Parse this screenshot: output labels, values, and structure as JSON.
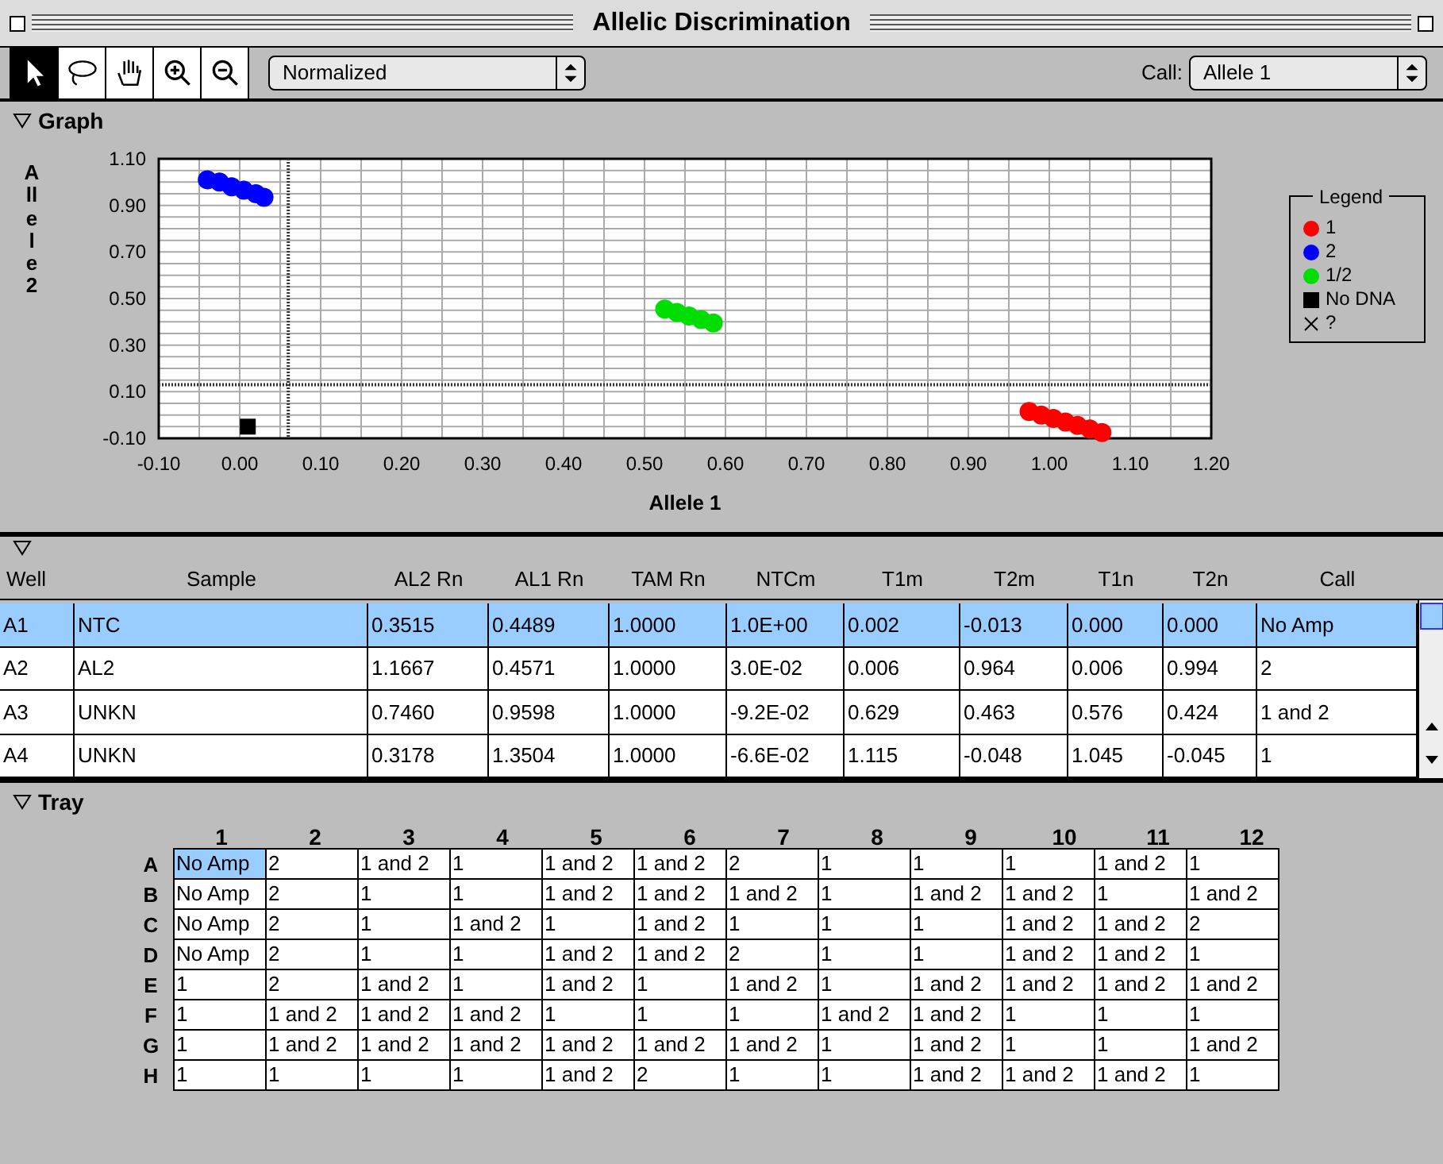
{
  "window": {
    "title": "Allelic Discrimination"
  },
  "toolbar": {
    "tools": [
      {
        "kind": "pointer",
        "selected": true
      },
      {
        "kind": "lasso",
        "selected": false
      },
      {
        "kind": "hand",
        "selected": false
      },
      {
        "kind": "zoom-in",
        "selected": false
      },
      {
        "kind": "zoom-out",
        "selected": false
      }
    ],
    "view_select": {
      "value": "Normalized"
    },
    "call_label": "Call:",
    "call_select": {
      "value": "Allele 1"
    }
  },
  "graph": {
    "title": "Graph",
    "chart_data": {
      "type": "scatter",
      "grid": true,
      "xlabel": "Allele 1",
      "ylabel": "Allele 2",
      "xlim": [
        -0.1,
        1.2
      ],
      "ylim": [
        -0.1,
        1.1
      ],
      "xticks": [
        {
          "value": -0.1,
          "label": "-0.10"
        },
        {
          "value": 0,
          "label": "0.00"
        },
        {
          "value": 0.1,
          "label": "0.10"
        },
        {
          "value": 0.2,
          "label": "0.20"
        },
        {
          "value": 0.3,
          "label": "0.30"
        },
        {
          "value": 0.4,
          "label": "0.40"
        },
        {
          "value": 0.5,
          "label": "0.50"
        },
        {
          "value": 0.6,
          "label": "0.60"
        },
        {
          "value": 0.7,
          "label": "0.70"
        },
        {
          "value": 0.8,
          "label": "0.80"
        },
        {
          "value": 0.9,
          "label": "0.90"
        },
        {
          "value": 1.0,
          "label": "1.00"
        },
        {
          "value": 1.1,
          "label": "1.10"
        },
        {
          "value": 1.2,
          "label": "1.20"
        }
      ],
      "yticks": [
        {
          "value": 1.1,
          "label": "1.10"
        },
        {
          "value": 0.9,
          "label": "0.90"
        },
        {
          "value": 0.7,
          "label": "0.70"
        },
        {
          "value": 0.5,
          "label": "0.50"
        },
        {
          "value": 0.3,
          "label": "0.30"
        },
        {
          "value": 0.1,
          "label": "0.10"
        },
        {
          "value": -0.1,
          "label": "-0.10"
        }
      ],
      "series": [
        {
          "name": "1",
          "color": "#ff0000",
          "marker": "circle",
          "x": [
            0.975,
            0.99,
            1.005,
            1.02,
            1.035,
            1.05,
            1.065
          ],
          "values": [
            0.015,
            0.0,
            -0.015,
            -0.03,
            -0.045,
            -0.06,
            -0.075
          ]
        },
        {
          "name": "2",
          "color": "#0000ff",
          "marker": "circle",
          "x": [
            -0.04,
            -0.025,
            -0.01,
            0.005,
            0.02,
            0.03
          ],
          "values": [
            1.01,
            1.0,
            0.98,
            0.965,
            0.95,
            0.935
          ]
        },
        {
          "name": "1/2",
          "color": "#00dd00",
          "marker": "circle",
          "x": [
            0.525,
            0.54,
            0.555,
            0.57,
            0.585
          ],
          "values": [
            0.455,
            0.44,
            0.425,
            0.41,
            0.395
          ]
        },
        {
          "name": "No DNA",
          "color": "#000000",
          "marker": "square",
          "x": [
            0.01
          ],
          "values": [
            -0.05
          ]
        }
      ],
      "ref_lines": [
        {
          "axis": "x",
          "value": 0.06
        },
        {
          "axis": "y",
          "value": 0.13
        }
      ]
    },
    "legend": {
      "title": "Legend",
      "extra_items": [
        {
          "label": "?",
          "kind": "cross"
        }
      ]
    }
  },
  "table": {
    "columns": [
      "Well",
      "Sample",
      "AL2 Rn",
      "AL1 Rn",
      "TAM Rn",
      "NTCm",
      "T1m",
      "T2m",
      "T1n",
      "T2n",
      "Call"
    ],
    "rows": [
      {
        "selected": true,
        "cells": [
          "A1",
          "NTC",
          "0.3515",
          "0.4489",
          "1.0000",
          "1.0E+00",
          "0.002",
          "-0.013",
          "0.000",
          "0.000",
          "No Amp"
        ]
      },
      {
        "selected": false,
        "cells": [
          "A2",
          "AL2",
          "1.1667",
          "0.4571",
          "1.0000",
          "3.0E-02",
          "0.006",
          "0.964",
          "0.006",
          "0.994",
          "2"
        ]
      },
      {
        "selected": false,
        "cells": [
          "A3",
          "UNKN",
          "0.7460",
          "0.9598",
          "1.0000",
          "-9.2E-02",
          "0.629",
          "0.463",
          "0.576",
          "0.424",
          "1 and 2"
        ]
      },
      {
        "selected": false,
        "cells": [
          "A4",
          "UNKN",
          "0.3178",
          "1.3504",
          "1.0000",
          "-6.6E-02",
          "1.115",
          "-0.048",
          "1.045",
          "-0.045",
          "1"
        ]
      }
    ]
  },
  "tray": {
    "title": "Tray",
    "columns": [
      "1",
      "2",
      "3",
      "4",
      "5",
      "6",
      "7",
      "8",
      "9",
      "10",
      "11",
      "12"
    ],
    "rows": [
      {
        "label": "A",
        "cells": [
          {
            "call": "No Amp",
            "selected": true
          },
          {
            "call": "2",
            "selected": false
          },
          {
            "call": "1 and 2",
            "selected": false
          },
          {
            "call": "1",
            "selected": false
          },
          {
            "call": "1 and 2",
            "selected": false
          },
          {
            "call": "1 and 2",
            "selected": false
          },
          {
            "call": "2",
            "selected": false
          },
          {
            "call": "1",
            "selected": false
          },
          {
            "call": "1",
            "selected": false
          },
          {
            "call": "1",
            "selected": false
          },
          {
            "call": "1 and 2",
            "selected": false
          },
          {
            "call": "1",
            "selected": false
          }
        ]
      },
      {
        "label": "B",
        "cells": [
          {
            "call": "No Amp",
            "selected": false
          },
          {
            "call": "2",
            "selected": false
          },
          {
            "call": "1",
            "selected": false
          },
          {
            "call": "1",
            "selected": false
          },
          {
            "call": "1 and 2",
            "selected": false
          },
          {
            "call": "1 and 2",
            "selected": false
          },
          {
            "call": "1 and 2",
            "selected": false
          },
          {
            "call": "1",
            "selected": false
          },
          {
            "call": "1 and 2",
            "selected": false
          },
          {
            "call": "1 and 2",
            "selected": false
          },
          {
            "call": "1",
            "selected": false
          },
          {
            "call": "1 and 2",
            "selected": false
          }
        ]
      },
      {
        "label": "C",
        "cells": [
          {
            "call": "No Amp",
            "selected": false
          },
          {
            "call": "2",
            "selected": false
          },
          {
            "call": "1",
            "selected": false
          },
          {
            "call": "1 and 2",
            "selected": false
          },
          {
            "call": "1",
            "selected": false
          },
          {
            "call": "1 and 2",
            "selected": false
          },
          {
            "call": "1",
            "selected": false
          },
          {
            "call": "1",
            "selected": false
          },
          {
            "call": "1",
            "selected": false
          },
          {
            "call": "1 and 2",
            "selected": false
          },
          {
            "call": "1 and 2",
            "selected": false
          },
          {
            "call": "2",
            "selected": false
          }
        ]
      },
      {
        "label": "D",
        "cells": [
          {
            "call": "No Amp",
            "selected": false
          },
          {
            "call": "2",
            "selected": false
          },
          {
            "call": "1",
            "selected": false
          },
          {
            "call": "1",
            "selected": false
          },
          {
            "call": "1 and 2",
            "selected": false
          },
          {
            "call": "1 and 2",
            "selected": false
          },
          {
            "call": "2",
            "selected": false
          },
          {
            "call": "1",
            "selected": false
          },
          {
            "call": "1",
            "selected": false
          },
          {
            "call": "1 and 2",
            "selected": false
          },
          {
            "call": "1 and 2",
            "selected": false
          },
          {
            "call": "1",
            "selected": false
          }
        ]
      },
      {
        "label": "E",
        "cells": [
          {
            "call": "1",
            "selected": false
          },
          {
            "call": "2",
            "selected": false
          },
          {
            "call": "1 and 2",
            "selected": false
          },
          {
            "call": "1",
            "selected": false
          },
          {
            "call": "1 and 2",
            "selected": false
          },
          {
            "call": "1",
            "selected": false
          },
          {
            "call": "1 and 2",
            "selected": false
          },
          {
            "call": "1",
            "selected": false
          },
          {
            "call": "1 and 2",
            "selected": false
          },
          {
            "call": "1 and 2",
            "selected": false
          },
          {
            "call": "1 and 2",
            "selected": false
          },
          {
            "call": "1 and 2",
            "selected": false
          }
        ]
      },
      {
        "label": "F",
        "cells": [
          {
            "call": "1",
            "selected": false
          },
          {
            "call": "1 and 2",
            "selected": false
          },
          {
            "call": "1 and 2",
            "selected": false
          },
          {
            "call": "1 and 2",
            "selected": false
          },
          {
            "call": "1",
            "selected": false
          },
          {
            "call": "1",
            "selected": false
          },
          {
            "call": "1",
            "selected": false
          },
          {
            "call": "1 and 2",
            "selected": false
          },
          {
            "call": "1 and 2",
            "selected": false
          },
          {
            "call": "1",
            "selected": false
          },
          {
            "call": "1",
            "selected": false
          },
          {
            "call": "1",
            "selected": false
          }
        ]
      },
      {
        "label": "G",
        "cells": [
          {
            "call": "1",
            "selected": false
          },
          {
            "call": "1 and 2",
            "selected": false
          },
          {
            "call": "1 and 2",
            "selected": false
          },
          {
            "call": "1 and 2",
            "selected": false
          },
          {
            "call": "1 and 2",
            "selected": false
          },
          {
            "call": "1 and 2",
            "selected": false
          },
          {
            "call": "1 and 2",
            "selected": false
          },
          {
            "call": "1",
            "selected": false
          },
          {
            "call": "1 and 2",
            "selected": false
          },
          {
            "call": "1",
            "selected": false
          },
          {
            "call": "1",
            "selected": false
          },
          {
            "call": "1 and 2",
            "selected": false
          }
        ]
      },
      {
        "label": "H",
        "cells": [
          {
            "call": "1",
            "selected": false
          },
          {
            "call": "1",
            "selected": false
          },
          {
            "call": "1",
            "selected": false
          },
          {
            "call": "1",
            "selected": false
          },
          {
            "call": "1 and 2",
            "selected": false
          },
          {
            "call": "2",
            "selected": false
          },
          {
            "call": "1",
            "selected": false
          },
          {
            "call": "1",
            "selected": false
          },
          {
            "call": "1 and 2",
            "selected": false
          },
          {
            "call": "1 and 2",
            "selected": false
          },
          {
            "call": "1 and 2",
            "selected": false
          },
          {
            "call": "1",
            "selected": false
          }
        ]
      }
    ]
  }
}
